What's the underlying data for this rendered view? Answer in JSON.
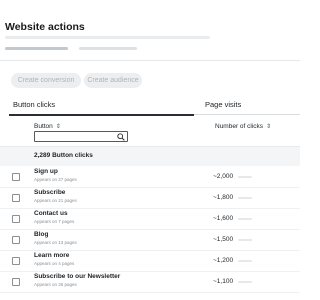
{
  "page": {
    "title": "Website actions"
  },
  "actions": {
    "create_conversion": "Create conversion",
    "create_audience": "Create audience"
  },
  "sections": {
    "button_clicks": "Button clicks",
    "page_visits": "Page visits"
  },
  "table": {
    "col_button": "Button",
    "col_clicks": "Number of clicks",
    "search": {
      "placeholder": "",
      "value": ""
    },
    "summary": "2,289 Button clicks",
    "rows": [
      {
        "label": "Sign up",
        "sub": "Appears on 27 pages",
        "clicks": "~2,000"
      },
      {
        "label": "Subscribe",
        "sub": "Appears on 21 pages",
        "clicks": "~1,800"
      },
      {
        "label": "Contact us",
        "sub": "Appears on 7 pages",
        "clicks": "~1,600"
      },
      {
        "label": "Blog",
        "sub": "Appears on 13 pages",
        "clicks": "~1,500"
      },
      {
        "label": "Learn more",
        "sub": "Appears on 4 pages",
        "clicks": "~1,200"
      },
      {
        "label": "Subscribe to our Newsletter",
        "sub": "Appears on 26 pages",
        "clicks": "~1,100"
      }
    ]
  },
  "icons": {
    "sort": "sort-icon",
    "search": "search-icon"
  }
}
